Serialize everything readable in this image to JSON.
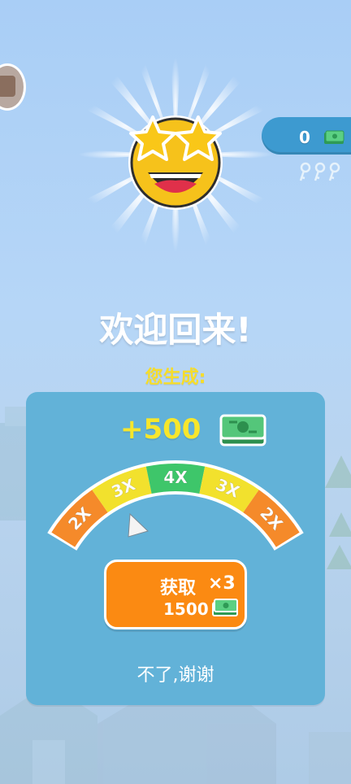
{
  "currency": {
    "value": "0",
    "icon": "cash-icon"
  },
  "welcome": {
    "title": "欢迎回来!",
    "subtitle": "您生成:"
  },
  "reward": {
    "amount": "+500",
    "icon": "cash-stack-icon"
  },
  "meter": {
    "segments": [
      {
        "label": "2X",
        "color": "#f58a2a"
      },
      {
        "label": "3X",
        "color": "#f2e12d"
      },
      {
        "label": "4X",
        "color": "#3ec66a"
      },
      {
        "label": "3X",
        "color": "#f2e12d"
      },
      {
        "label": "2X",
        "color": "#f58a2a"
      }
    ]
  },
  "claim": {
    "label": "获取",
    "multiplier": "×3",
    "amount": "1500",
    "icon": "cash-icon"
  },
  "decline": {
    "label": "不了,谢谢"
  },
  "colors": {
    "panel": "#62b2d8",
    "accent_yellow": "#f7e62c",
    "button_orange": "#fb8a12",
    "pill_blue": "#3d9ad0"
  }
}
